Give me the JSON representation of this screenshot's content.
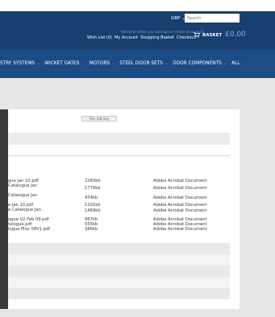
{
  "header": {
    "currency": "GBP",
    "currency_chevron": "⌄",
    "search_placeholder": "Search",
    "welcome": "Welcome visitor you can login or create an account.",
    "links": [
      "Wish List (0)",
      "My Account",
      "Shopping Basket",
      "Checkout"
    ],
    "basket_label": "BASKET",
    "basket_total": "£0.00"
  },
  "nav": {
    "items": [
      {
        "label": "STRY SYSTEMS",
        "chevron": "⌄"
      },
      {
        "label": "WICKET GATES",
        "chevron": "⌄"
      },
      {
        "label": "MOTORS",
        "chevron": "⌄"
      },
      {
        "label": "STEEL DOOR SETS",
        "chevron": "⌄"
      },
      {
        "label": "DOOR COMPONENTS",
        "chevron": "⌄"
      },
      {
        "label": "ALL",
        "chevron": "⌄"
      }
    ]
  },
  "main": {
    "file_library_label": "File Library",
    "files": [
      {
        "name": "gue Jan 10.pdf",
        "size": "2283kb",
        "type": "Adobe Acrobat Document"
      },
      {
        "name": "Catalogue Jan",
        "size": "1779kb",
        "type": "Adobe Acrobat Document"
      },
      {
        "name": "Catalogue Jan",
        "size": "474kb",
        "type": "Adobe Acrobat Document"
      },
      {
        "name": "e Jan 10.pdf",
        "size": "1201kb",
        "type": "Adobe Acrobat Document"
      },
      {
        "name": "e Catalogue Jan",
        "size": "1469kb",
        "type": "Adobe Acrobat Document"
      },
      {
        "name": "ogue V2 Feb 09.pdf",
        "size": "967kb",
        "type": "Adobe Acrobat Document"
      },
      {
        "name": "talogue.pdf",
        "size": "555kb",
        "type": "Adobe Acrobat Document"
      },
      {
        "name": "logue May 08V1.pdf",
        "size": "386kb",
        "type": "Adobe Acrobat Document"
      }
    ]
  },
  "colors": {
    "header_bg": "#173f70",
    "nav_bg": "#1c4c86",
    "page_bg": "#e6e6e6"
  }
}
